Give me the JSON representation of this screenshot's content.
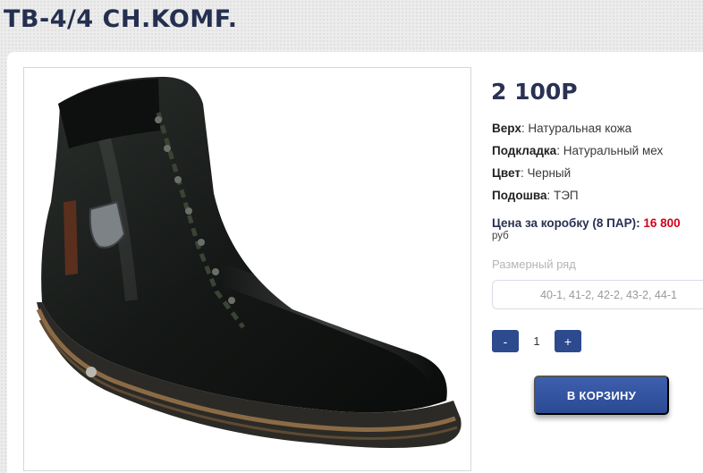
{
  "product": {
    "title": "ТВ-4/4 CH.KOMF.",
    "price": "2 100Р",
    "image_alt_icon": "boot-image"
  },
  "specs": [
    {
      "label": "Верх",
      "value": ": Натуральная кожа"
    },
    {
      "label": "Подкладка",
      "value": ": Натуральный мех"
    },
    {
      "label": "Цвет",
      "value": ": Черный"
    },
    {
      "label": "Подошва",
      "value": ": ТЭП"
    }
  ],
  "box": {
    "label": "Цена за коробку (8 ПАР): ",
    "value": "16 800",
    "unit": "руб"
  },
  "sizes": {
    "label": "Размерный ряд",
    "value": "40-1, 41-2, 42-2, 43-2, 44-1"
  },
  "quantity": {
    "minus": "-",
    "value": "1",
    "plus": "+"
  },
  "cart": {
    "label": "В КОРЗИНУ"
  },
  "colors": {
    "title": "#253050",
    "accent": "#2d4a8e",
    "price_red": "#d0021b"
  }
}
